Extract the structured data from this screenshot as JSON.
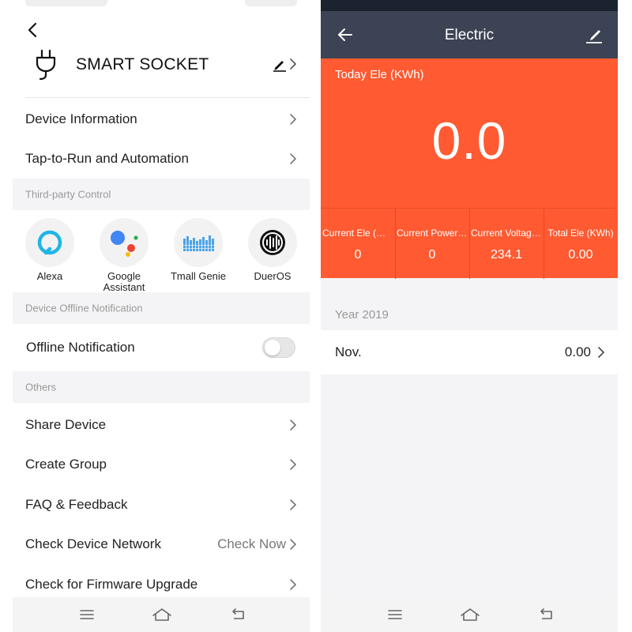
{
  "left": {
    "device_name": "SMART SOCKET",
    "menu_top": [
      {
        "label": "Device Information"
      },
      {
        "label": "Tap-to-Run and Automation"
      }
    ],
    "third_party_title": "Third-party Control",
    "third_party": [
      {
        "label": "Alexa",
        "icon": "alexa-icon"
      },
      {
        "label": "Google Assistant",
        "icon": "google-assistant-icon"
      },
      {
        "label": "Tmall Genie",
        "icon": "tmall-genie-icon"
      },
      {
        "label": "DuerOS",
        "icon": "dueros-icon"
      }
    ],
    "offline_title": "Device Offline Notification",
    "offline_label": "Offline Notification",
    "offline_enabled": false,
    "others_title": "Others",
    "others": [
      {
        "label": "Share Device",
        "value": ""
      },
      {
        "label": "Create Group",
        "value": ""
      },
      {
        "label": "FAQ & Feedback",
        "value": ""
      },
      {
        "label": "Check Device Network",
        "value": "Check Now"
      },
      {
        "label": "Check for Firmware Upgrade",
        "value": ""
      }
    ]
  },
  "right": {
    "title": "Electric",
    "today_label": "Today Ele (KWh)",
    "today_value": "0.0",
    "stats": [
      {
        "label": "Current Ele (mA)",
        "value": "0"
      },
      {
        "label": "Current Power(W)",
        "value": "0"
      },
      {
        "label": "Current Voltage(V)",
        "value": "234.1"
      },
      {
        "label": "Total Ele (KWh)",
        "value": "0.00"
      }
    ],
    "year_label": "Year 2019",
    "months": [
      {
        "label": "Nov.",
        "value": "0.00"
      }
    ]
  },
  "colors": {
    "accent_orange": "#ff5a31",
    "appbar_dark": "#3b4354",
    "section_bg": "#f4f4f6"
  }
}
